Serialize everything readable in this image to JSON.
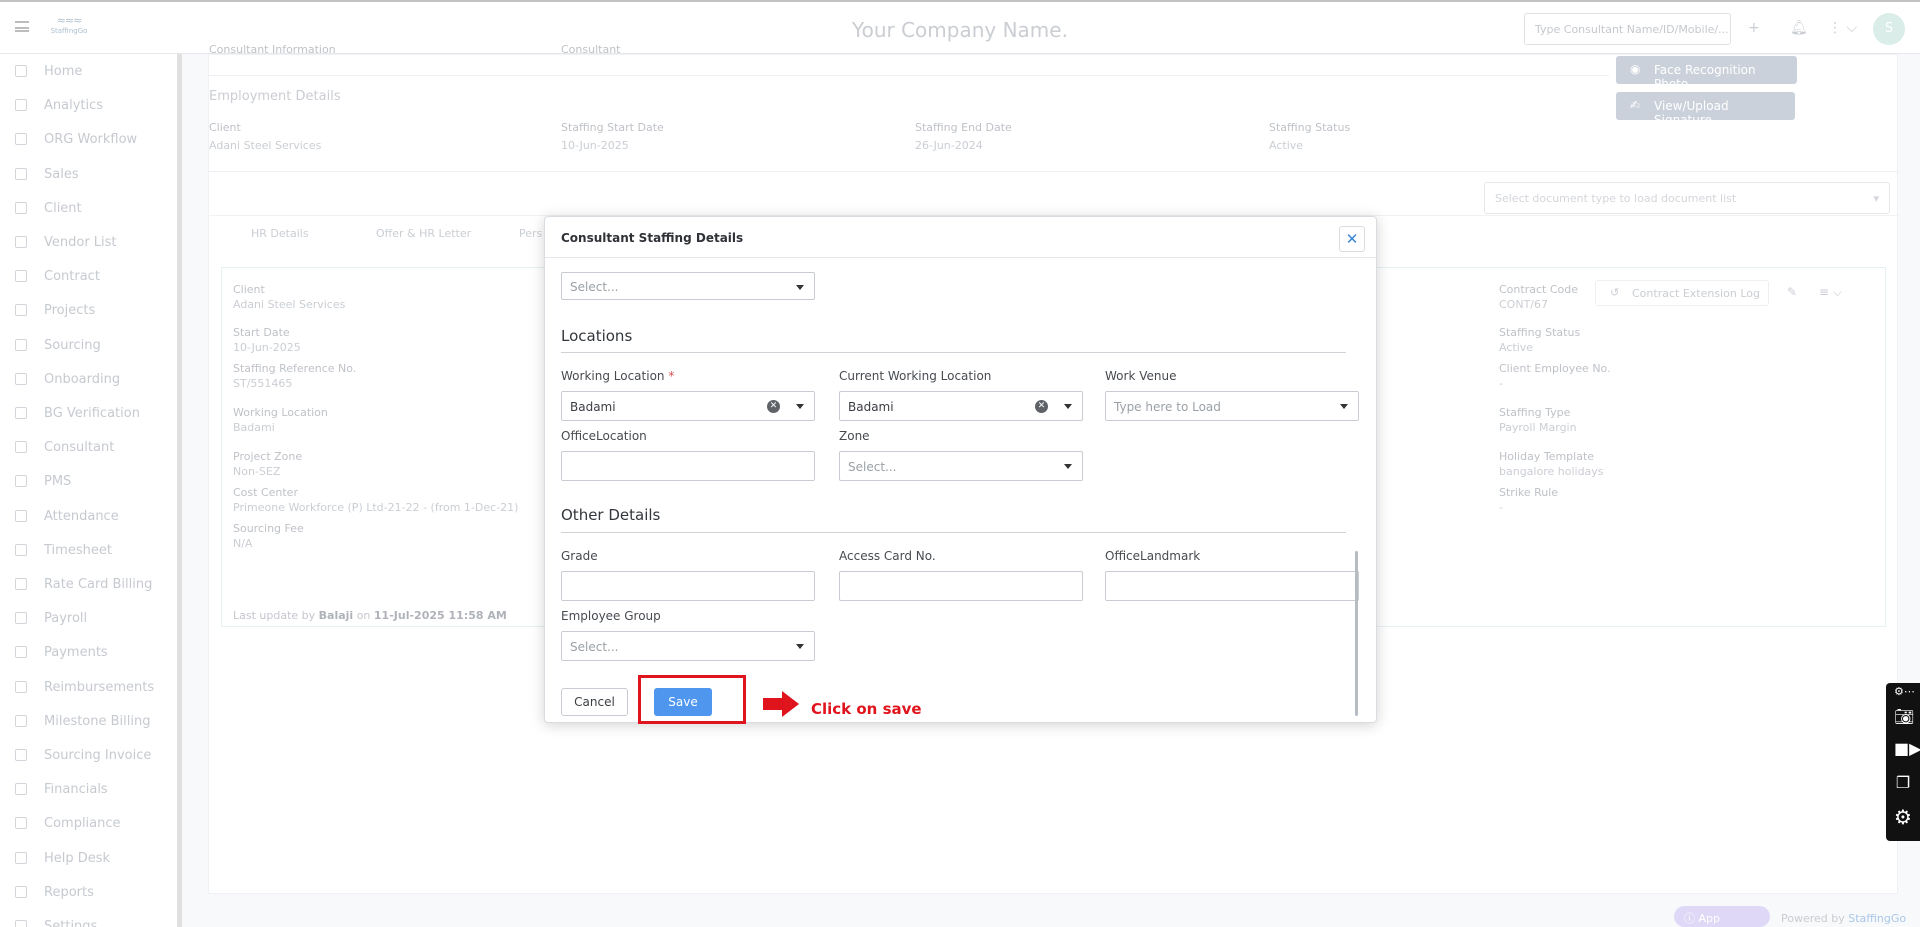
{
  "header": {
    "company_name": "Your Company Name.",
    "logo_text": "StaffingGo",
    "search_placeholder": "Type Consultant Name/ID/Mobile/...",
    "avatar_initial": "S"
  },
  "sidebar": {
    "items": [
      {
        "label": "Home",
        "icon": "home-icon"
      },
      {
        "label": "Analytics",
        "icon": "analytics-icon"
      },
      {
        "label": "ORG Workflow",
        "icon": "workflow-icon"
      },
      {
        "label": "Sales",
        "icon": "sales-icon"
      },
      {
        "label": "Client",
        "icon": "client-icon"
      },
      {
        "label": "Vendor List",
        "icon": "vendor-icon"
      },
      {
        "label": "Contract",
        "icon": "contract-icon"
      },
      {
        "label": "Projects",
        "icon": "projects-icon"
      },
      {
        "label": "Sourcing",
        "icon": "sourcing-icon"
      },
      {
        "label": "Onboarding",
        "icon": "onboarding-icon"
      },
      {
        "label": "BG Verification",
        "icon": "verification-icon"
      },
      {
        "label": "Consultant",
        "icon": "consultant-icon"
      },
      {
        "label": "PMS",
        "icon": "pms-icon"
      },
      {
        "label": "Attendance",
        "icon": "attendance-icon"
      },
      {
        "label": "Timesheet",
        "icon": "timesheet-icon"
      },
      {
        "label": "Rate Card Billing",
        "icon": "rate-card-icon"
      },
      {
        "label": "Payroll",
        "icon": "payroll-icon"
      },
      {
        "label": "Payments",
        "icon": "rupee-icon"
      },
      {
        "label": "Reimbursements",
        "icon": "reimbursement-icon"
      },
      {
        "label": "Milestone Billing",
        "icon": "milestone-icon"
      },
      {
        "label": "Sourcing Invoice",
        "icon": "invoice-icon"
      },
      {
        "label": "Financials",
        "icon": "financials-icon"
      },
      {
        "label": "Compliance",
        "icon": "compliance-icon"
      },
      {
        "label": "Help Desk",
        "icon": "help-icon"
      },
      {
        "label": "Reports",
        "icon": "reports-icon"
      },
      {
        "label": "Settings",
        "icon": "settings-icon"
      }
    ]
  },
  "background": {
    "top_cut_label": "Consultant Information",
    "top_cut_value": "Consultant",
    "face_btn": "Face Recognition Photo",
    "signature_btn": "View/Upload Signature",
    "employment_title": "Employment Details",
    "employment": [
      {
        "label": "Client",
        "value": "Adani Steel Services"
      },
      {
        "label": "Staffing Start Date",
        "value": "10-Jun-2025"
      },
      {
        "label": "Staffing End Date",
        "value": "26-Jun-2024"
      },
      {
        "label": "Staffing Status",
        "value": "Active"
      }
    ],
    "doc_select_placeholder": "Select document type to load document list",
    "tabs": [
      "HR Details",
      "Offer & HR Letter",
      "Pers"
    ],
    "contract_log_btn": "Contract Extension Log",
    "left_fields": [
      {
        "label": "Client",
        "value": "Adani Steel Services"
      },
      {
        "label": "Start Date",
        "value": "10-Jun-2025"
      },
      {
        "label": "Staffing Reference No.",
        "value": "ST/551465"
      },
      {
        "label": "Working Location",
        "value": "Badami"
      },
      {
        "label": "Project Zone",
        "value": "Non-SEZ"
      },
      {
        "label": "Cost Center",
        "value": "Primeone Workforce (P) Ltd-21-22 - (from 1-Dec-21)"
      },
      {
        "label": "Sourcing Fee",
        "value": "N/A"
      }
    ],
    "right_fields": [
      {
        "label": "Contract Code",
        "value": "CONT/67"
      },
      {
        "label": "Staffing Status",
        "value": "Active"
      },
      {
        "label": "Client Employee No.",
        "value": "-"
      },
      {
        "label": "Staffing Type",
        "value": "Payroll Margin"
      },
      {
        "label": "Holiday Template",
        "value": "bangalore holidays"
      },
      {
        "label": "Strike Rule",
        "value": "-"
      }
    ],
    "last_update_prefix": "Last update by",
    "last_update_user": "Balaji",
    "last_update_on": "on",
    "last_update_time": "11-Jul-2025 11:58 AM"
  },
  "modal": {
    "title": "Consultant Staffing Details",
    "top_select_placeholder": "Select...",
    "locations_title": "Locations",
    "working_location_label": "Working Location",
    "working_location_value": "Badami",
    "current_working_location_label": "Current Working Location",
    "current_working_location_value": "Badami",
    "work_venue_label": "Work Venue",
    "work_venue_placeholder": "Type here to Load",
    "office_location_label": "OfficeLocation",
    "office_location_value": "",
    "zone_label": "Zone",
    "zone_placeholder": "Select...",
    "other_title": "Other Details",
    "grade_label": "Grade",
    "grade_value": "",
    "access_card_label": "Access Card No.",
    "access_card_value": "",
    "office_landmark_label": "OfficeLandmark",
    "office_landmark_value": "",
    "employee_group_label": "Employee Group",
    "employee_group_placeholder": "Select...",
    "cancel_label": "Cancel",
    "save_label": "Save"
  },
  "annotation": {
    "callout": "Click on save",
    "color": "#e0141c"
  },
  "footer": {
    "app_support": "App support",
    "powered_by": "Powered by",
    "brand": "StaffingGo"
  },
  "colors": {
    "accent": "#4f96ef",
    "required": "#d9534f",
    "close": "#3a86d6"
  }
}
